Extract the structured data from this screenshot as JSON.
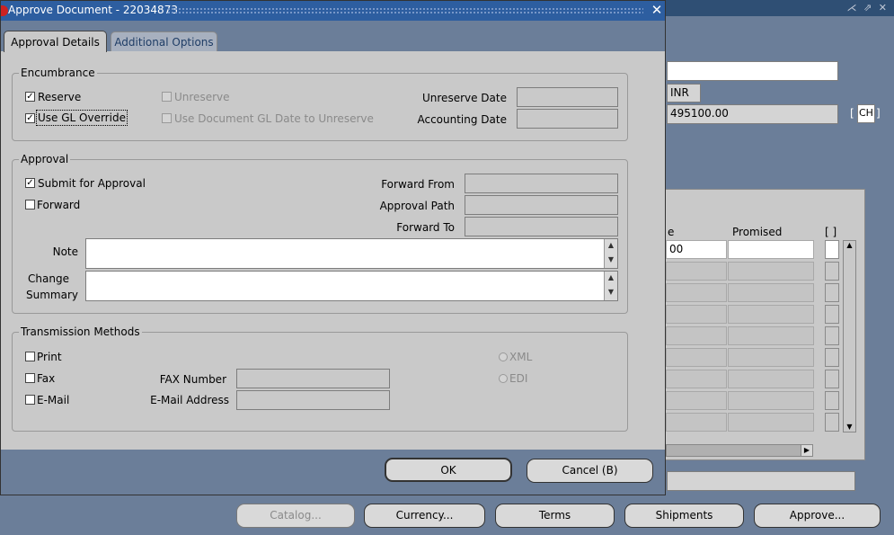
{
  "dialog": {
    "title": "Approve Document - 22034873",
    "close_glyph": "✕",
    "tabs": [
      {
        "label": "Approval Details",
        "active": true
      },
      {
        "label": "Additional Options",
        "active": false
      }
    ],
    "encumbrance": {
      "label": "Encumbrance",
      "reserve": "Reserve",
      "reserve_checked": true,
      "use_gl_override": "Use GL Override",
      "use_gl_override_checked": true,
      "unreserve": "Unreserve",
      "use_doc_gl_date": "Use Document GL Date to Unreserve",
      "unreserve_date_label": "Unreserve Date",
      "accounting_date_label": "Accounting Date",
      "unreserve_date_value": "",
      "accounting_date_value": ""
    },
    "approval": {
      "label": "Approval",
      "submit": "Submit for Approval",
      "submit_checked": true,
      "forward": "Forward",
      "forward_checked": false,
      "forward_from_label": "Forward From",
      "approval_path_label": "Approval Path",
      "forward_to_label": "Forward To",
      "note_label": "Note",
      "change_summary_label_1": "Change",
      "change_summary_label_2": "Summary",
      "note_value": "",
      "change_summary_value": ""
    },
    "transmission": {
      "label": "Transmission Methods",
      "print": "Print",
      "fax": "Fax",
      "email": "E-Mail",
      "fax_number_label": "FAX Number",
      "email_address_label": "E-Mail Address",
      "xml": "XML",
      "edi": "EDI"
    },
    "ok_label": "OK",
    "cancel_label": "Cancel (B)"
  },
  "background": {
    "window_icons": "⋌ ⇗ ✕",
    "currency_code": "INR",
    "amount": "495100.00",
    "ch_label": "CH",
    "bracket_left": "[",
    "bracket_right": "]",
    "col_partial": "e",
    "col_promised": "Promised",
    "col_selector": "[ ]",
    "first_row_value": "00",
    "buttons": {
      "catalog": "Catalog...",
      "currency": "Currency...",
      "terms": "Terms",
      "shipments": "Shipments",
      "approve": "Approve..."
    }
  },
  "colors": {
    "titlebar": "#2d5ea0",
    "dialog_bg": "#c9c9c9",
    "desktop_bg": "#6b7e99"
  }
}
